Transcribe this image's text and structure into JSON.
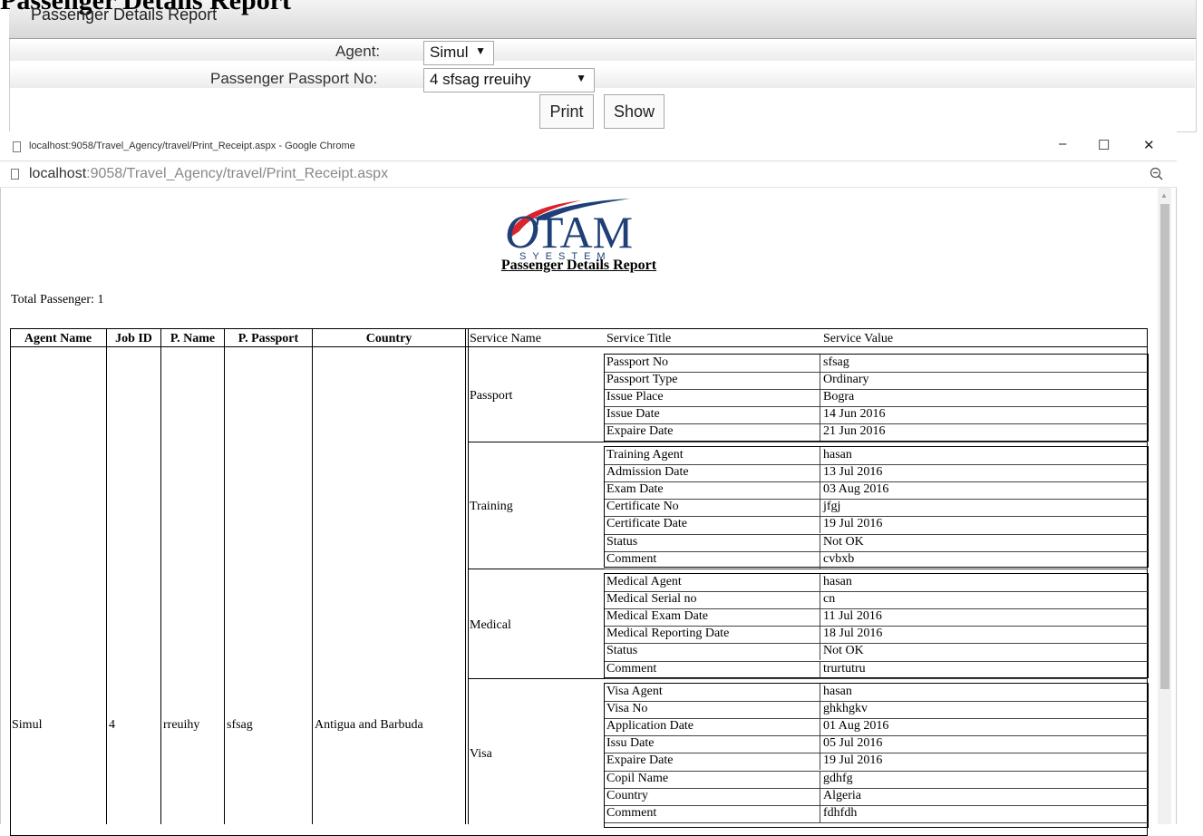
{
  "background_form": {
    "heading": "Passenger Details Report",
    "panel_title": "Passenger Details Report",
    "agent_label": "Agent:",
    "agent_value": "Simul",
    "passport_label": "Passenger Passport No:",
    "passport_value": "4 sfsag rreuihy",
    "print_button": "Print",
    "show_button": "Show"
  },
  "popup": {
    "window_title": "localhost:9058/Travel_Agency/travel/Print_Receipt.aspx - Google Chrome",
    "address_host": "localhost",
    "address_path": ":9058/Travel_Agency/travel/Print_Receipt.aspx",
    "minimize": "–",
    "maximize": "☐",
    "close": "✕",
    "zoom_icon": "zoom-icon"
  },
  "report": {
    "logo_text": "OTAM",
    "logo_sub": "SYESTEM",
    "title": "Passenger Details Report",
    "total_label": "Total Passenger: 1",
    "columns": [
      "Agent Name",
      "Job ID",
      "P. Name",
      "P. Passport",
      "Country",
      "Service Name",
      "Service Title",
      "Service Value"
    ],
    "row": {
      "agent_name": "Simul",
      "job_id": "4",
      "p_name": "rreuihy",
      "p_passport": "sfsag",
      "country": "Antigua and Barbuda"
    },
    "services": [
      {
        "name": "Passport",
        "items": [
          [
            "Passport No",
            "sfsag"
          ],
          [
            "Passport Type",
            "Ordinary"
          ],
          [
            "Issue Place",
            "Bogra"
          ],
          [
            "Issue Date",
            "14 Jun 2016"
          ],
          [
            "Expaire Date",
            "21 Jun 2016"
          ]
        ]
      },
      {
        "name": "Training",
        "items": [
          [
            "Training Agent",
            "hasan"
          ],
          [
            "Admission Date",
            "13 Jul 2016"
          ],
          [
            "Exam Date",
            "03 Aug 2016"
          ],
          [
            "Certificate No",
            "jfgj"
          ],
          [
            "Certificate Date",
            "19 Jul 2016"
          ],
          [
            "Status",
            "Not OK"
          ],
          [
            "Comment",
            "cvbxb"
          ]
        ]
      },
      {
        "name": "Medical",
        "items": [
          [
            "Medical Agent",
            "hasan"
          ],
          [
            "Medical Serial no",
            "cn"
          ],
          [
            "Medical Exam Date",
            "11 Jul 2016"
          ],
          [
            "Medical Reporting Date",
            "18 Jul 2016"
          ],
          [
            "Status",
            "Not OK"
          ],
          [
            "Comment",
            "trurtutru"
          ]
        ]
      },
      {
        "name": "Visa",
        "items": [
          [
            "Visa Agent",
            "hasan"
          ],
          [
            "Visa No",
            "ghkhgkv"
          ],
          [
            "Application Date",
            "01 Aug 2016"
          ],
          [
            "Issu Date",
            "05 Jul 2016"
          ],
          [
            "Expaire Date",
            "19 Jul 2016"
          ],
          [
            "Copil Name",
            "gdhfg"
          ],
          [
            "Country",
            "Algeria"
          ],
          [
            "Comment",
            "fdhfdh"
          ]
        ]
      }
    ]
  }
}
